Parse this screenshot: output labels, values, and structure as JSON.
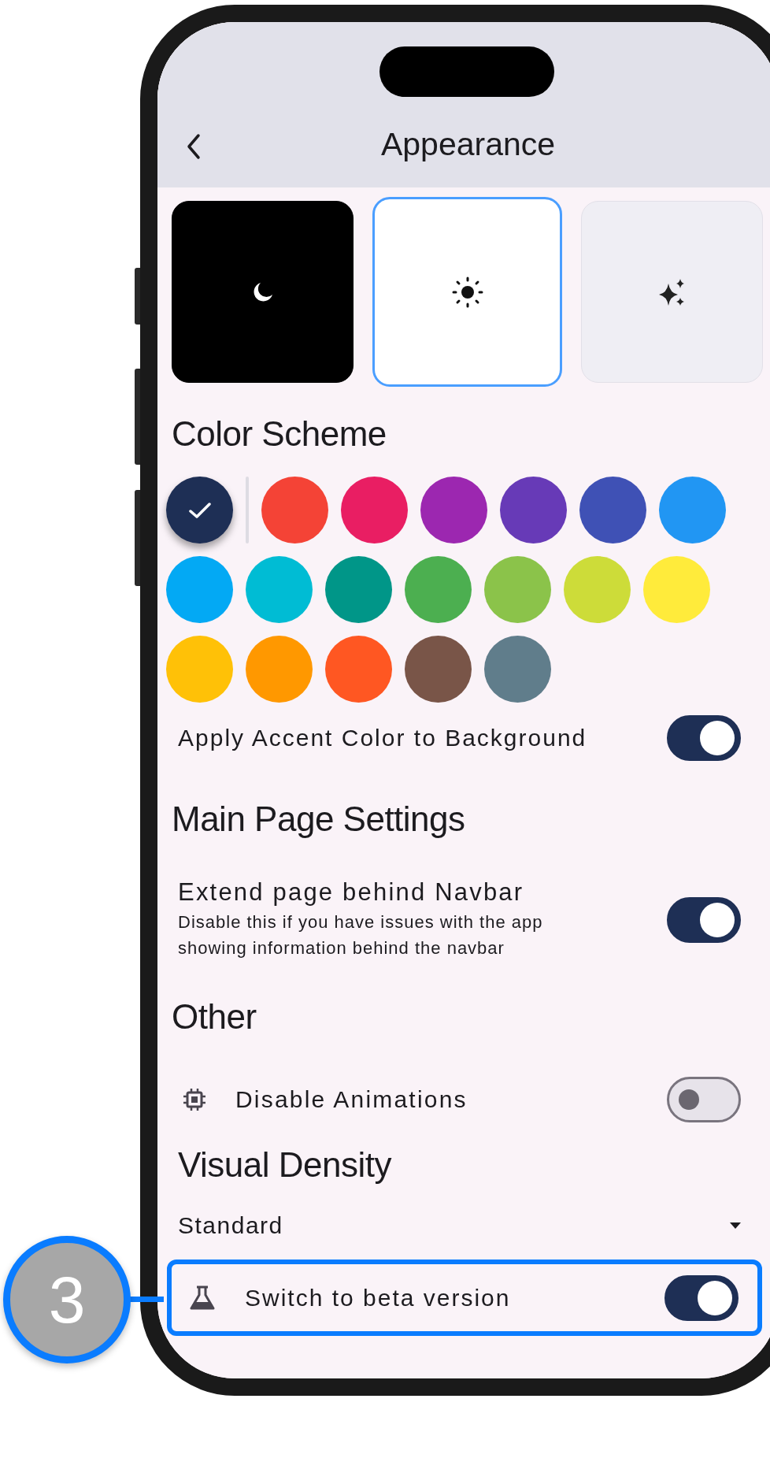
{
  "header": {
    "title": "Appearance"
  },
  "theme_tiles": [
    {
      "kind": "dark",
      "selected": false
    },
    {
      "kind": "light",
      "selected": true
    },
    {
      "kind": "system",
      "selected": false
    }
  ],
  "color_scheme": {
    "title": "Color Scheme",
    "swatches": [
      {
        "color": "#1e2f55",
        "selected": true
      },
      {
        "color": "#f44336",
        "selected": false
      },
      {
        "color": "#e91e63",
        "selected": false
      },
      {
        "color": "#9c27b0",
        "selected": false
      },
      {
        "color": "#673ab7",
        "selected": false
      },
      {
        "color": "#3f51b5",
        "selected": false
      },
      {
        "color": "#2196f3",
        "selected": false
      },
      {
        "color": "#03a9f4",
        "selected": false
      },
      {
        "color": "#00bcd4",
        "selected": false
      },
      {
        "color": "#009688",
        "selected": false
      },
      {
        "color": "#4caf50",
        "selected": false
      },
      {
        "color": "#8bc34a",
        "selected": false
      },
      {
        "color": "#cddc39",
        "selected": false
      },
      {
        "color": "#ffeb3b",
        "selected": false
      },
      {
        "color": "#ffc107",
        "selected": false
      },
      {
        "color": "#ff9800",
        "selected": false
      },
      {
        "color": "#ff5722",
        "selected": false
      },
      {
        "color": "#795548",
        "selected": false
      },
      {
        "color": "#607d8b",
        "selected": false
      }
    ]
  },
  "accent_background": {
    "label": "Apply Accent Color to Background",
    "on": true
  },
  "main_page_settings": {
    "title": "Main Page Settings",
    "extend_navbar": {
      "label": "Extend page behind Navbar",
      "description": "Disable this if you have issues with the app showing information behind the navbar",
      "on": true
    }
  },
  "other": {
    "title": "Other",
    "disable_animations": {
      "label": "Disable Animations",
      "on": false
    }
  },
  "visual_density": {
    "title": "Visual Density",
    "value": "Standard"
  },
  "beta": {
    "label": "Switch to beta version",
    "on": true,
    "highlighted": true
  },
  "callout": {
    "number": "3"
  }
}
